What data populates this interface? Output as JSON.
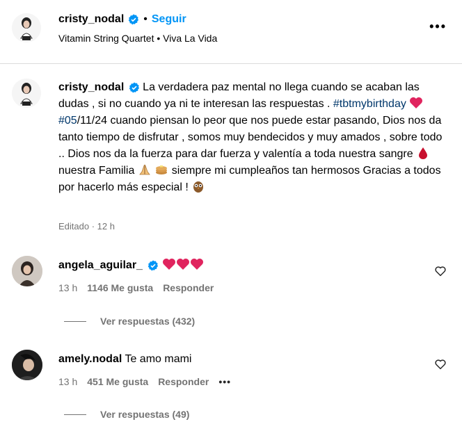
{
  "header": {
    "username": "cristy_nodal",
    "separator": "•",
    "follow_label": "Seguir",
    "audio": "Vitamin String Quartet • Viva La Vida",
    "more_icon": "more-options-icon"
  },
  "post": {
    "username": "cristy_nodal",
    "text_1": " La verdadera paz mental no llega cuando se acaban las dudas , si no cuando ya ni te interesan las respuestas . ",
    "hashtag_1": "#tbtmybirthday",
    "hashtag_2": "#05",
    "text_2": "/11/24 cuando piensan lo peor que nos puede estar pasando, Dios nos da tanto tiempo de disfrutar , somos muy bendecidos y muy amados , sobre todo .. Dios nos da la fuerza para dar fuerza y valentía a toda nuestra sangre ",
    "text_3": " nuestra Familia ",
    "text_4": " siempre mi cumpleaños tan hermosos Gracias a todos por hacerlo más especial ! ",
    "meta": "Editado · 12 h"
  },
  "comments": [
    {
      "username": "angela_aguilar_",
      "text": "",
      "time": "13 h",
      "likes": "1146 Me gusta",
      "reply_label": "Responder",
      "view_replies": "Ver respuestas (432)"
    },
    {
      "username": "amely.nodal",
      "text": "Te amo mami",
      "time": "13 h",
      "likes": "451 Me gusta",
      "reply_label": "Responder",
      "more": "•••",
      "view_replies": "Ver respuestas (49)"
    }
  ],
  "colors": {
    "link": "#0095f6",
    "hashtag": "#00376b",
    "muted": "#737373",
    "verified": "#0095f6",
    "heart": "#e0245e"
  }
}
